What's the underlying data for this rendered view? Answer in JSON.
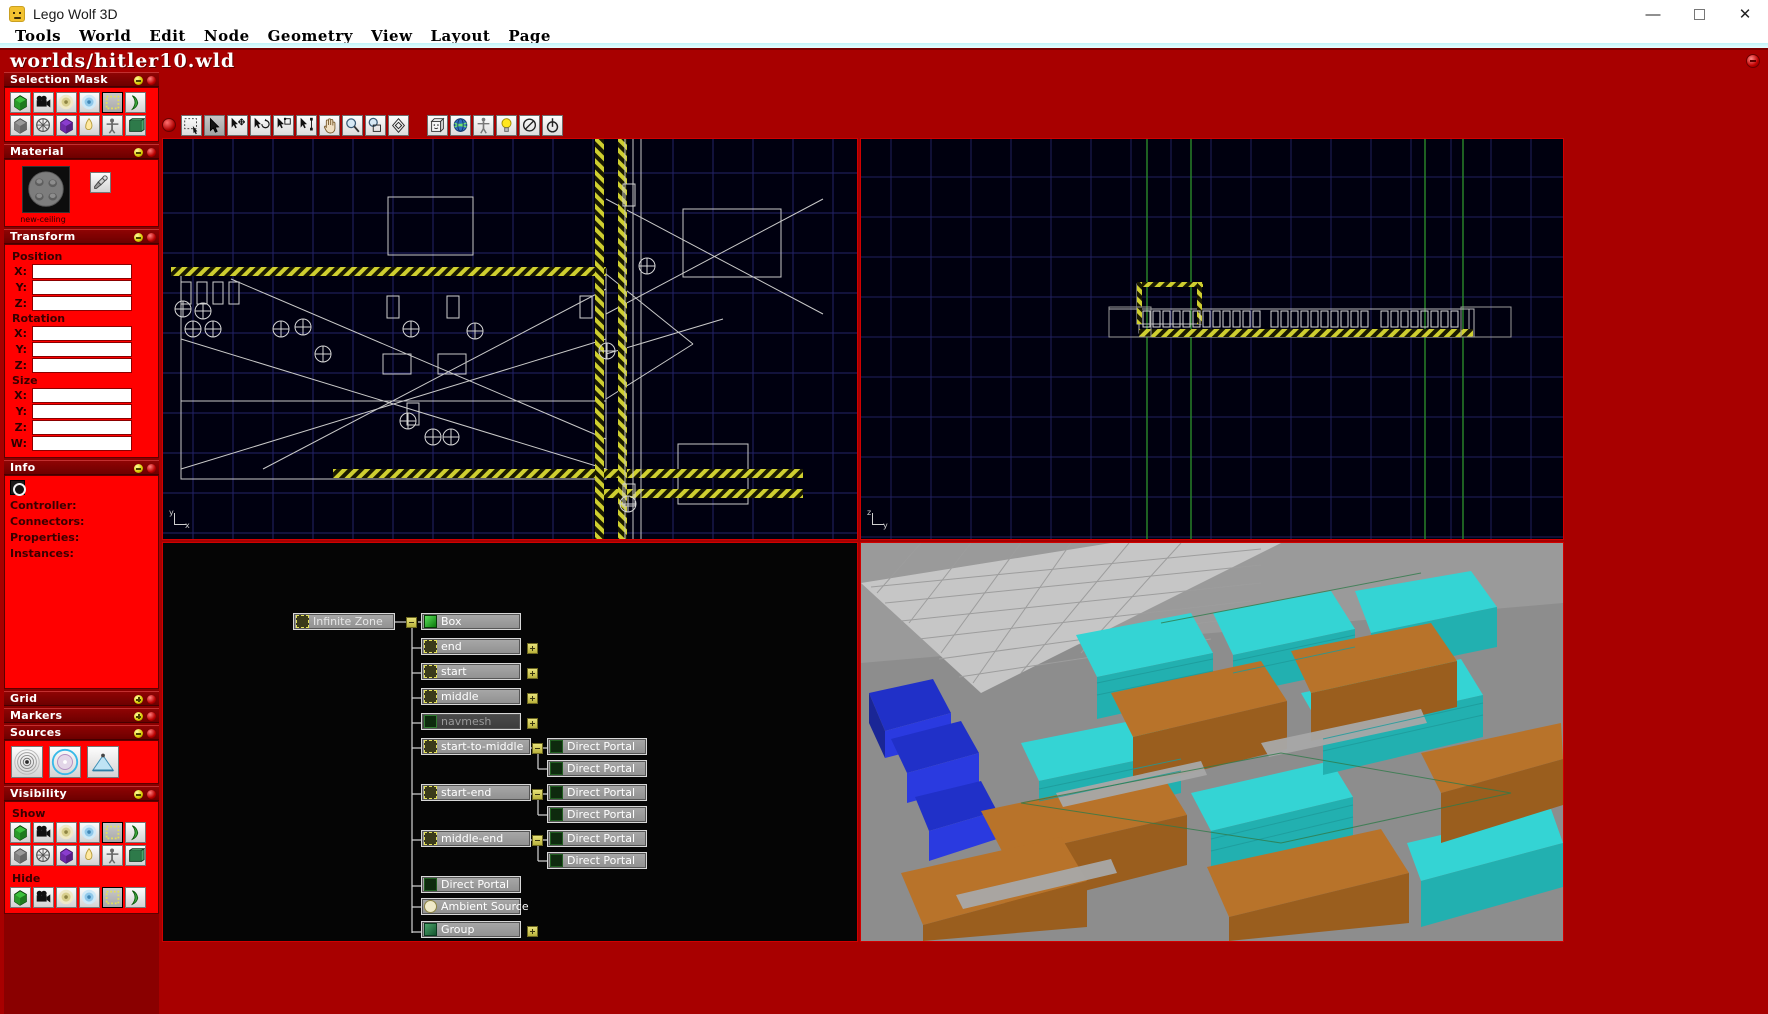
{
  "window": {
    "title": "Lego Wolf 3D",
    "app_icon": "lego-minifig-icon",
    "controls": {
      "minimize": "—",
      "maximize": "▫",
      "close": "✕"
    }
  },
  "menubar": {
    "items": [
      {
        "label": "Tools"
      },
      {
        "label": "World"
      },
      {
        "label": "Edit"
      },
      {
        "label": "Node"
      },
      {
        "label": "Geometry"
      },
      {
        "label": "View"
      },
      {
        "label": "Layout"
      },
      {
        "label": "Page"
      }
    ]
  },
  "document": {
    "path": "worlds/hitler10.wld",
    "close_label": "−"
  },
  "toolbar": {
    "record_indicator": "record-dot",
    "tools": [
      {
        "name": "rubber-band-select-tool",
        "active": false
      },
      {
        "name": "pointer-select-tool",
        "active": true
      },
      {
        "name": "move-tool",
        "active": false
      },
      {
        "name": "rotate-tool",
        "active": false
      },
      {
        "name": "scale-tool",
        "active": false
      },
      {
        "name": "vertex-edit-tool",
        "active": false
      },
      {
        "name": "pan-hand-tool",
        "active": false
      },
      {
        "name": "zoom-magnifier-tool",
        "active": false
      },
      {
        "name": "zoom-region-tool",
        "active": false
      },
      {
        "name": "center-view-tool",
        "active": false
      },
      {
        "name": "box-geometry-tool",
        "active": false
      },
      {
        "name": "world-globe-tool",
        "active": false
      },
      {
        "name": "entity-actor-tool",
        "active": false
      },
      {
        "name": "light-bulb-tool",
        "active": false
      },
      {
        "name": "no-clip-tool",
        "active": false
      },
      {
        "name": "portal-tool",
        "active": false
      }
    ]
  },
  "sidebar": {
    "panels": [
      {
        "id": "selection-mask",
        "title": "Selection Mask",
        "collapsed": false,
        "header_buttons": [
          "collapse",
          "close"
        ],
        "tiles": [
          {
            "name": "brush-geometry-icon",
            "selected": false
          },
          {
            "name": "camera-icon",
            "selected": false
          },
          {
            "name": "sound-source-icon",
            "selected": false
          },
          {
            "name": "light-source-icon",
            "selected": false
          },
          {
            "name": "zone-icon",
            "selected": true
          },
          {
            "name": "portal-icon",
            "selected": false
          },
          {
            "name": "solid-block-icon",
            "selected": false
          },
          {
            "name": "navmesh-icon",
            "selected": false
          },
          {
            "name": "entity-icon",
            "selected": false
          },
          {
            "name": "flame-icon",
            "selected": false
          },
          {
            "name": "actor-icon",
            "selected": false
          },
          {
            "name": "group-icon",
            "selected": false
          }
        ]
      },
      {
        "id": "material",
        "title": "Material",
        "collapsed": false,
        "header_buttons": [
          "collapse",
          "close"
        ],
        "swatch_name": "material-preview",
        "material_name": "new-ceiling",
        "eyedropper": "eyedropper-icon"
      },
      {
        "id": "transform",
        "title": "Transform",
        "collapsed": false,
        "header_buttons": [
          "collapse",
          "close"
        ],
        "groups": [
          {
            "label": "Position",
            "fields": [
              {
                "axis": "X:",
                "value": "",
                "placeholder": ""
              },
              {
                "axis": "Y:",
                "value": "",
                "placeholder": ""
              },
              {
                "axis": "Z:",
                "value": "",
                "placeholder": ""
              }
            ]
          },
          {
            "label": "Rotation",
            "fields": [
              {
                "axis": "X:",
                "value": "",
                "placeholder": ""
              },
              {
                "axis": "Y:",
                "value": "",
                "placeholder": ""
              },
              {
                "axis": "Z:",
                "value": "",
                "placeholder": ""
              }
            ]
          },
          {
            "label": "Size",
            "fields": [
              {
                "axis": "X:",
                "value": "",
                "placeholder": ""
              },
              {
                "axis": "Y:",
                "value": "",
                "placeholder": ""
              },
              {
                "axis": "Z:",
                "value": "",
                "placeholder": ""
              },
              {
                "axis": "W:",
                "value": "",
                "placeholder": ""
              }
            ]
          }
        ]
      },
      {
        "id": "info",
        "title": "Info",
        "collapsed": false,
        "header_buttons": [
          "collapse",
          "close"
        ],
        "swatch": "node-color-swatch",
        "lines": [
          {
            "label": "Controller:"
          },
          {
            "label": "Connectors:"
          },
          {
            "label": "Properties:"
          },
          {
            "label": "Instances:"
          }
        ]
      },
      {
        "id": "grid",
        "title": "Grid",
        "collapsed": true,
        "header_buttons": [
          "expand",
          "close"
        ]
      },
      {
        "id": "markers",
        "title": "Markers",
        "collapsed": true,
        "header_buttons": [
          "expand",
          "close"
        ]
      },
      {
        "id": "sources",
        "title": "Sources",
        "collapsed": false,
        "header_buttons": [
          "collapse",
          "close"
        ],
        "tiles": [
          {
            "name": "point-sound-source-icon"
          },
          {
            "name": "omni-light-source-icon"
          },
          {
            "name": "spot-light-source-icon"
          }
        ]
      },
      {
        "id": "visibility",
        "title": "Visibility",
        "collapsed": false,
        "header_buttons": [
          "collapse",
          "close"
        ],
        "show_label": "Show",
        "hide_label": "Hide",
        "show_tiles": [
          {
            "name": "brush-geometry-icon"
          },
          {
            "name": "camera-icon"
          },
          {
            "name": "sound-source-icon"
          },
          {
            "name": "light-source-icon"
          },
          {
            "name": "zone-icon"
          },
          {
            "name": "portal-icon"
          },
          {
            "name": "solid-block-icon"
          },
          {
            "name": "navmesh-icon"
          },
          {
            "name": "entity-icon"
          },
          {
            "name": "flame-icon"
          },
          {
            "name": "actor-icon"
          },
          {
            "name": "group-icon"
          }
        ],
        "hide_tiles": [
          {
            "name": "brush-geometry-icon"
          },
          {
            "name": "camera-icon"
          },
          {
            "name": "sound-source-icon"
          },
          {
            "name": "light-source-icon"
          },
          {
            "name": "zone-icon"
          },
          {
            "name": "portal-icon"
          }
        ]
      }
    ]
  },
  "viewports": {
    "top_left": {
      "name": "top-orthographic-view",
      "axis_x": "x",
      "axis_y": "y"
    },
    "top_right": {
      "name": "side-orthographic-view",
      "axis_x": "y",
      "axis_y": "z"
    },
    "bottom_left": {
      "name": "node-graph-view"
    },
    "bottom_right": {
      "name": "perspective-3d-view"
    }
  },
  "node_graph": {
    "root": {
      "label": "Infinite Zone",
      "icon": "zone-icon",
      "expander": "collapse"
    },
    "children": [
      {
        "label": "Box",
        "icon": "brush-geometry-icon",
        "expander": null,
        "indent": 0,
        "dim": false
      },
      {
        "label": "end",
        "icon": "zone-icon",
        "expander": "expand",
        "indent": 0,
        "dim": false
      },
      {
        "label": "start",
        "icon": "zone-icon",
        "expander": "expand",
        "indent": 0,
        "dim": false
      },
      {
        "label": "middle",
        "icon": "zone-icon",
        "expander": "expand",
        "indent": 0,
        "dim": false
      },
      {
        "label": "navmesh",
        "icon": "navmesh-icon",
        "expander": "expand",
        "indent": 0,
        "dim": true
      },
      {
        "label": "start-to-middle",
        "icon": "zone-icon",
        "expander": "collapse",
        "indent": 0,
        "dim": false,
        "children": [
          {
            "label": "Direct Portal",
            "icon": "portal-icon"
          },
          {
            "label": "Direct Portal",
            "icon": "portal-icon"
          }
        ]
      },
      {
        "label": "start-end",
        "icon": "zone-icon",
        "expander": "collapse",
        "indent": 0,
        "dim": false,
        "children": [
          {
            "label": "Direct Portal",
            "icon": "portal-icon"
          },
          {
            "label": "Direct Portal",
            "icon": "portal-icon"
          }
        ]
      },
      {
        "label": "middle-end",
        "icon": "zone-icon",
        "expander": "collapse",
        "indent": 0,
        "dim": false,
        "children": [
          {
            "label": "Direct Portal",
            "icon": "portal-icon"
          },
          {
            "label": "Direct Portal",
            "icon": "portal-icon"
          }
        ]
      },
      {
        "label": "Direct Portal",
        "icon": "portal-icon",
        "expander": null,
        "indent": 0,
        "dim": false
      },
      {
        "label": "Ambient Source",
        "icon": "sound-source-icon",
        "expander": null,
        "indent": 0,
        "dim": false
      },
      {
        "label": "Group",
        "icon": "group-icon",
        "expander": "expand",
        "indent": 0,
        "dim": false
      }
    ]
  },
  "colors": {
    "frame_red": "#a80000",
    "panel_red": "#ff0000",
    "panel_header_dark": "#6d0000",
    "viewport_bg": "#000010",
    "grid_line": "#2a2a6a",
    "geometry_line": "#c8c8c8",
    "hazard_yellow": "#d8d830",
    "node_fill": "#989898",
    "expander_yellow": "#c8c24a",
    "3d_floor": "#8a8a8a",
    "3d_teal": "#2ec8c8",
    "3d_orange": "#b8732a",
    "3d_blue": "#2030c0",
    "menu_underline": "#bff3f8"
  }
}
